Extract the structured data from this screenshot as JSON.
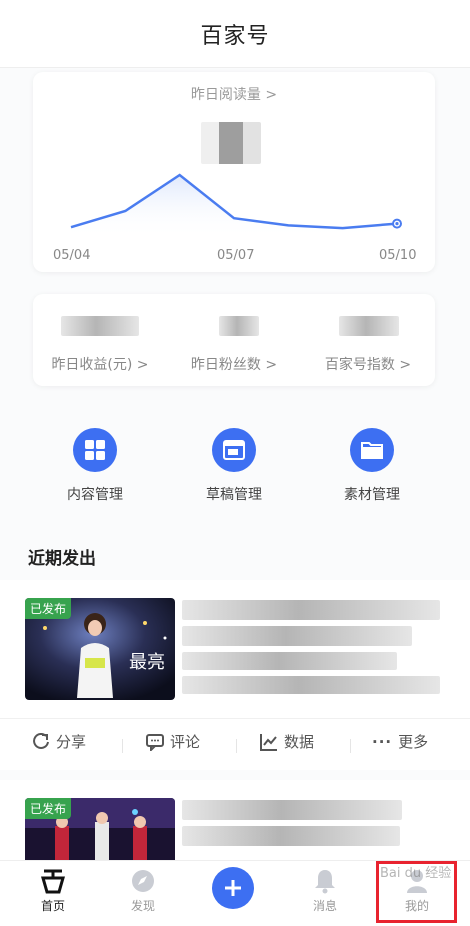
{
  "header": {
    "title": "百家号"
  },
  "read_card": {
    "title": "昨日阅读量 >",
    "x_labels": [
      "05/04",
      "05/07",
      "05/10"
    ]
  },
  "chart_data": {
    "type": "area",
    "x": [
      "05/04",
      "05/05",
      "05/06",
      "05/07",
      "05/08",
      "05/09",
      "05/10"
    ],
    "series": [
      {
        "values": [
          12,
          30,
          70,
          22,
          14,
          11,
          16
        ]
      }
    ],
    "ylim": [
      0,
      80
    ],
    "grid": false,
    "color": "#4a7cf0"
  },
  "stats": [
    {
      "label": "昨日收益(元) >"
    },
    {
      "label": "昨日粉丝数 >"
    },
    {
      "label": "百家号指数 >"
    }
  ],
  "tools": [
    {
      "label": "内容管理",
      "icon": "grid-icon"
    },
    {
      "label": "草稿管理",
      "icon": "draft-icon"
    },
    {
      "label": "素材管理",
      "icon": "folder-icon"
    }
  ],
  "recent": {
    "title": "近期发出",
    "posts": [
      {
        "badge": "已发布",
        "thumb_text": "最亮"
      },
      {
        "badge": "已发布"
      }
    ],
    "actions": [
      "分享",
      "评论",
      "数据",
      "更多"
    ]
  },
  "tabbar": {
    "items": [
      "首页",
      "发现",
      "消息",
      "我的"
    ]
  },
  "colors": {
    "accent": "#3d6ff2",
    "published": "#37a34e",
    "highlight": "#e8232f"
  },
  "watermark": "Bai du 经验"
}
